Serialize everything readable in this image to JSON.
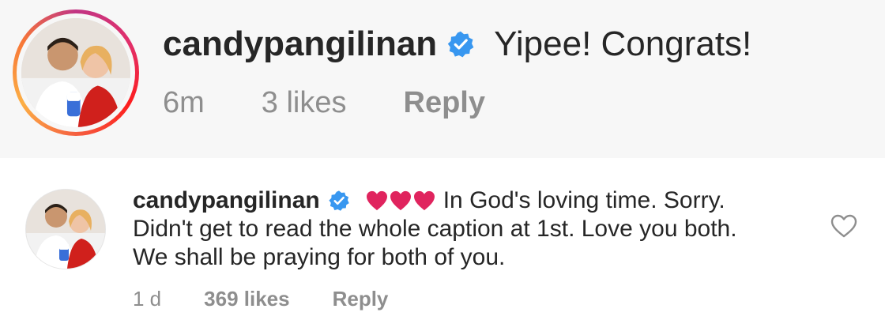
{
  "comments": [
    {
      "username": "candypangilinan",
      "text": "Yipee! Congrats!",
      "time": "6m",
      "likes": "3 likes",
      "reply_label": "Reply",
      "avatar": "avatar-photo",
      "story_ring": true
    },
    {
      "username": "candypangilinan",
      "hearts": [
        "red-heart-emoji",
        "red-heart-emoji",
        "red-heart-emoji"
      ],
      "text_line1": "In God's loving time. Sorry.",
      "text_line2": "Didn't get to read the whole caption at 1st. Love you both.",
      "text_line3": "We shall be praying for both of you.",
      "time": "1 d",
      "likes": "369 likes",
      "reply_label": "Reply",
      "avatar": "avatar-photo",
      "like_icon": "heart-outline-icon"
    }
  ],
  "colors": {
    "verified_badge": "#3897f0",
    "heart_emoji": "#e0245e",
    "meta_text": "#8e8e8e",
    "primary_text": "#262626",
    "highlight_bg": "#f7f7f7"
  }
}
